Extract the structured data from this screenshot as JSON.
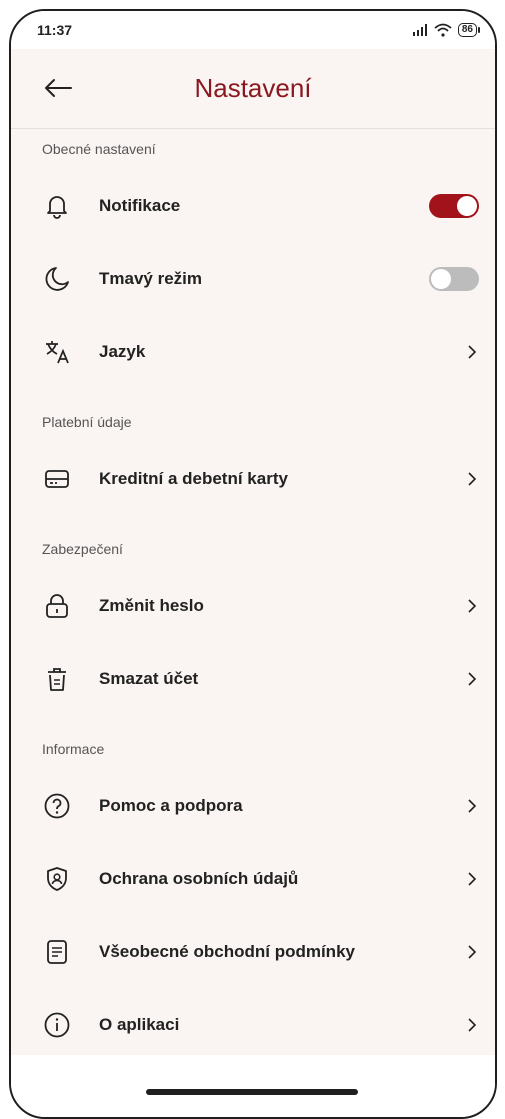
{
  "status": {
    "time": "11:37",
    "battery": "86"
  },
  "header": {
    "title": "Nastavení"
  },
  "sections": {
    "general": {
      "label": "Obecné nastavení",
      "notifications": {
        "label": "Notifikace",
        "enabled": true
      },
      "dark_mode": {
        "label": "Tmavý režim",
        "enabled": false
      },
      "language": {
        "label": "Jazyk"
      }
    },
    "payment": {
      "label": "Platební údaje",
      "cards": {
        "label": "Kreditní a debetní karty"
      }
    },
    "security": {
      "label": "Zabezpečení",
      "change_password": {
        "label": "Změnit heslo"
      },
      "delete_account": {
        "label": "Smazat účet"
      }
    },
    "info": {
      "label": "Informace",
      "help": {
        "label": "Pomoc a podpora"
      },
      "privacy": {
        "label": "Ochrana osobních údajů"
      },
      "terms": {
        "label": "Všeobecné obchodní podmínky"
      },
      "about": {
        "label": "O aplikaci"
      }
    }
  },
  "colors": {
    "accent": "#8a1820",
    "toggle_on": "#a1121a",
    "background": "#faf4f2"
  }
}
